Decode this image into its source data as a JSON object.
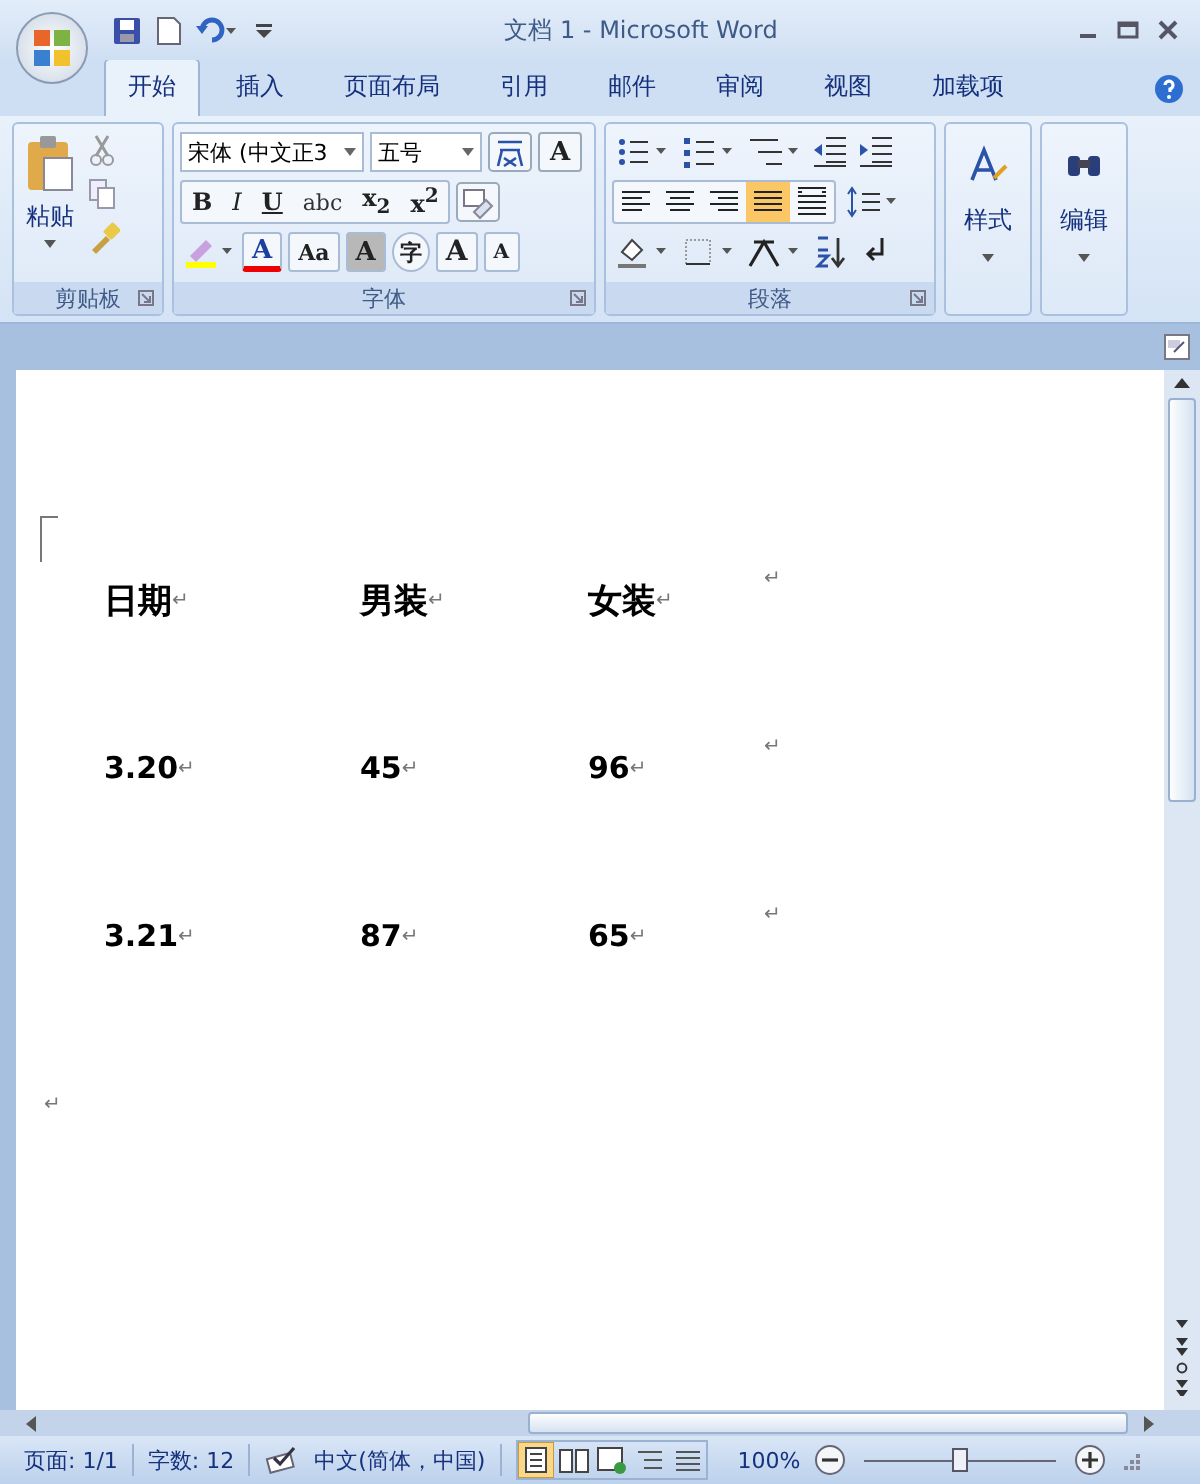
{
  "window": {
    "title": "文档 1 - Microsoft Word"
  },
  "tabs": [
    {
      "label": "开始",
      "selected": true
    },
    {
      "label": "插入",
      "selected": false
    },
    {
      "label": "页面布局",
      "selected": false
    },
    {
      "label": "引用",
      "selected": false
    },
    {
      "label": "邮件",
      "selected": false
    },
    {
      "label": "审阅",
      "selected": false
    },
    {
      "label": "视图",
      "selected": false
    },
    {
      "label": "加载项",
      "selected": false
    }
  ],
  "ribbon": {
    "clipboard": {
      "label": "剪贴板",
      "paste": "粘贴"
    },
    "font": {
      "label": "字体",
      "font_name": "宋体 (中文正3",
      "font_size": "五号",
      "boxed_a": "A",
      "format_buttons": [
        {
          "kind": "bold",
          "label": "B"
        },
        {
          "kind": "italic",
          "label": "I"
        },
        {
          "kind": "underline",
          "label": "U"
        },
        {
          "kind": "strike",
          "label": "abc"
        },
        {
          "kind": "plain",
          "label": "x$_{2}$"
        },
        {
          "kind": "plain",
          "label": "x$^{2}$"
        }
      ],
      "effect_buttons": [
        {
          "kind": "color",
          "label": "A"
        },
        {
          "kind": "case",
          "label": "Aa"
        },
        {
          "kind": "shaded",
          "label": "A"
        },
        {
          "kind": "circled",
          "label": "字"
        },
        {
          "kind": "grow",
          "label": "A"
        },
        {
          "kind": "shrink",
          "label": "A"
        }
      ]
    },
    "paragraph": {
      "label": "段落",
      "align": [
        {
          "kind": "left",
          "selected": false
        },
        {
          "kind": "center",
          "selected": false
        },
        {
          "kind": "right",
          "selected": false
        },
        {
          "kind": "justify",
          "selected": true
        },
        {
          "kind": "distributed",
          "selected": false
        }
      ]
    },
    "styles": {
      "label": "样式"
    },
    "editing": {
      "label": "编辑"
    }
  },
  "document": {
    "rows": [
      {
        "cells": [
          {
            "text": "日期",
            "mark": "↵"
          },
          {
            "text": "男装",
            "mark": "↵"
          },
          {
            "text": "女装",
            "mark": "↵"
          }
        ],
        "end_mark": "↵"
      },
      {
        "cells": [
          {
            "text": "3.20",
            "mark": "↵"
          },
          {
            "text": "45",
            "mark": "↵"
          },
          {
            "text": "96",
            "mark": "↵"
          }
        ],
        "end_mark": "↵"
      },
      {
        "cells": [
          {
            "text": "3.21",
            "mark": "↵"
          },
          {
            "text": "87",
            "mark": "↵"
          },
          {
            "text": "65",
            "mark": "↵"
          }
        ],
        "end_mark": "↵"
      }
    ],
    "last_mark": "↵"
  },
  "status_bar": {
    "page": "页面: 1/1",
    "words": "字数: 12",
    "language": "中文(简体，中国)",
    "views": [
      {
        "kind": "print",
        "selected": true
      },
      {
        "kind": "reading",
        "selected": false
      },
      {
        "kind": "web",
        "selected": false
      },
      {
        "kind": "outline",
        "selected": false
      },
      {
        "kind": "draft",
        "selected": false
      }
    ],
    "zoom": "100%",
    "zoom_slider": {
      "level": 0.5
    }
  }
}
